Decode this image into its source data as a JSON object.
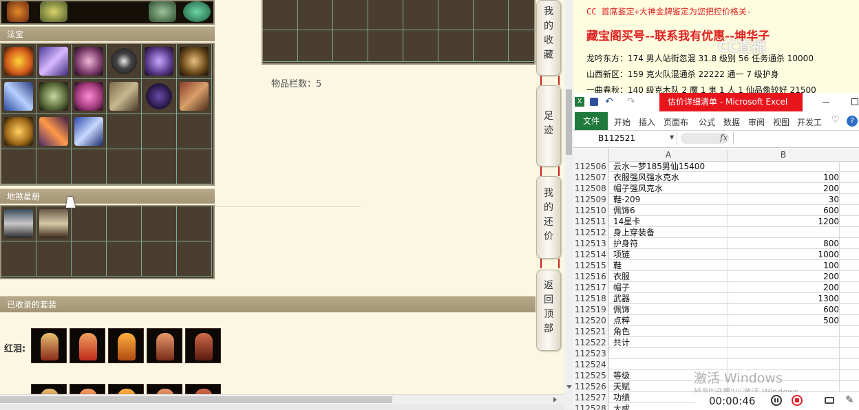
{
  "game": {
    "sections": {
      "fabao": "法宝",
      "dishaxingce": "地煞星册",
      "suits": "已收录的套装"
    },
    "inventory_count": "物品栏数：5",
    "suit_row_label": "红泪:",
    "side_tabs": [
      "我的收藏",
      "足迹",
      "我的还价",
      "返回顶部"
    ]
  },
  "doc": {
    "line1": "CC 首席鉴定+大神金牌鉴定为您把控价格关-",
    "line2": "藏宝阁买号--联系我有优惠--坤华子",
    "line3": "龙吟东方：174 男人站街忽混 31.8 级别 56 任务通杀 10000",
    "line4": "山西新区：159 克火队混通杀 22222 通一 7 级护身",
    "line5": "一曲春秋：140 级克木队 2 魔 1 鬼 1 人 1 仙品像较好 21500",
    "watermark": "CC直播"
  },
  "excel": {
    "window_title": "估价详细清单 - Microsoft Excel",
    "tabs": [
      "文件",
      "开始",
      "插入",
      "页面布",
      "公式",
      "数据",
      "审阅",
      "视图",
      "开发工"
    ],
    "name_box": "B112521",
    "fx": "fx",
    "col_a": "A",
    "col_b": "B",
    "rows": [
      {
        "n": "112506",
        "a": "云水一梦185男仙15400",
        "b": ""
      },
      {
        "n": "112507",
        "a": "衣服强风强水克水",
        "b": "100"
      },
      {
        "n": "112508",
        "a": "帽子强风克水",
        "b": "200"
      },
      {
        "n": "112509",
        "a": "鞋-209",
        "b": "30"
      },
      {
        "n": "112510",
        "a": "佩饰6",
        "b": "600"
      },
      {
        "n": "112511",
        "a": "14星卡",
        "b": "1200"
      },
      {
        "n": "112512",
        "a": "身上穿装备",
        "b": ""
      },
      {
        "n": "112513",
        "a": "护身符",
        "b": "800"
      },
      {
        "n": "112514",
        "a": "项链",
        "b": "1000"
      },
      {
        "n": "112515",
        "a": "鞋",
        "b": "100"
      },
      {
        "n": "112516",
        "a": "衣服",
        "b": "200"
      },
      {
        "n": "112517",
        "a": "帽子",
        "b": "200"
      },
      {
        "n": "112518",
        "a": "武器",
        "b": "1300"
      },
      {
        "n": "112519",
        "a": "佩饰",
        "b": "600"
      },
      {
        "n": "112520",
        "a": "点粹",
        "b": "500"
      },
      {
        "n": "112521",
        "a": "角色",
        "b": ""
      },
      {
        "n": "112522",
        "a": "共计",
        "b": ""
      },
      {
        "n": "112523",
        "a": "",
        "b": ""
      },
      {
        "n": "112524",
        "a": "",
        "b": ""
      },
      {
        "n": "112525",
        "a": "等级",
        "b": ""
      },
      {
        "n": "112526",
        "a": "天赋",
        "b": ""
      },
      {
        "n": "112527",
        "a": "功绩",
        "b": ""
      },
      {
        "n": "112528",
        "a": "大成",
        "b": ""
      }
    ]
  },
  "overlay": {
    "activate_title": "激活 Windows",
    "activate_sub": "转到\"设置\"以激活 Windows。",
    "timer": "00:00:46"
  }
}
